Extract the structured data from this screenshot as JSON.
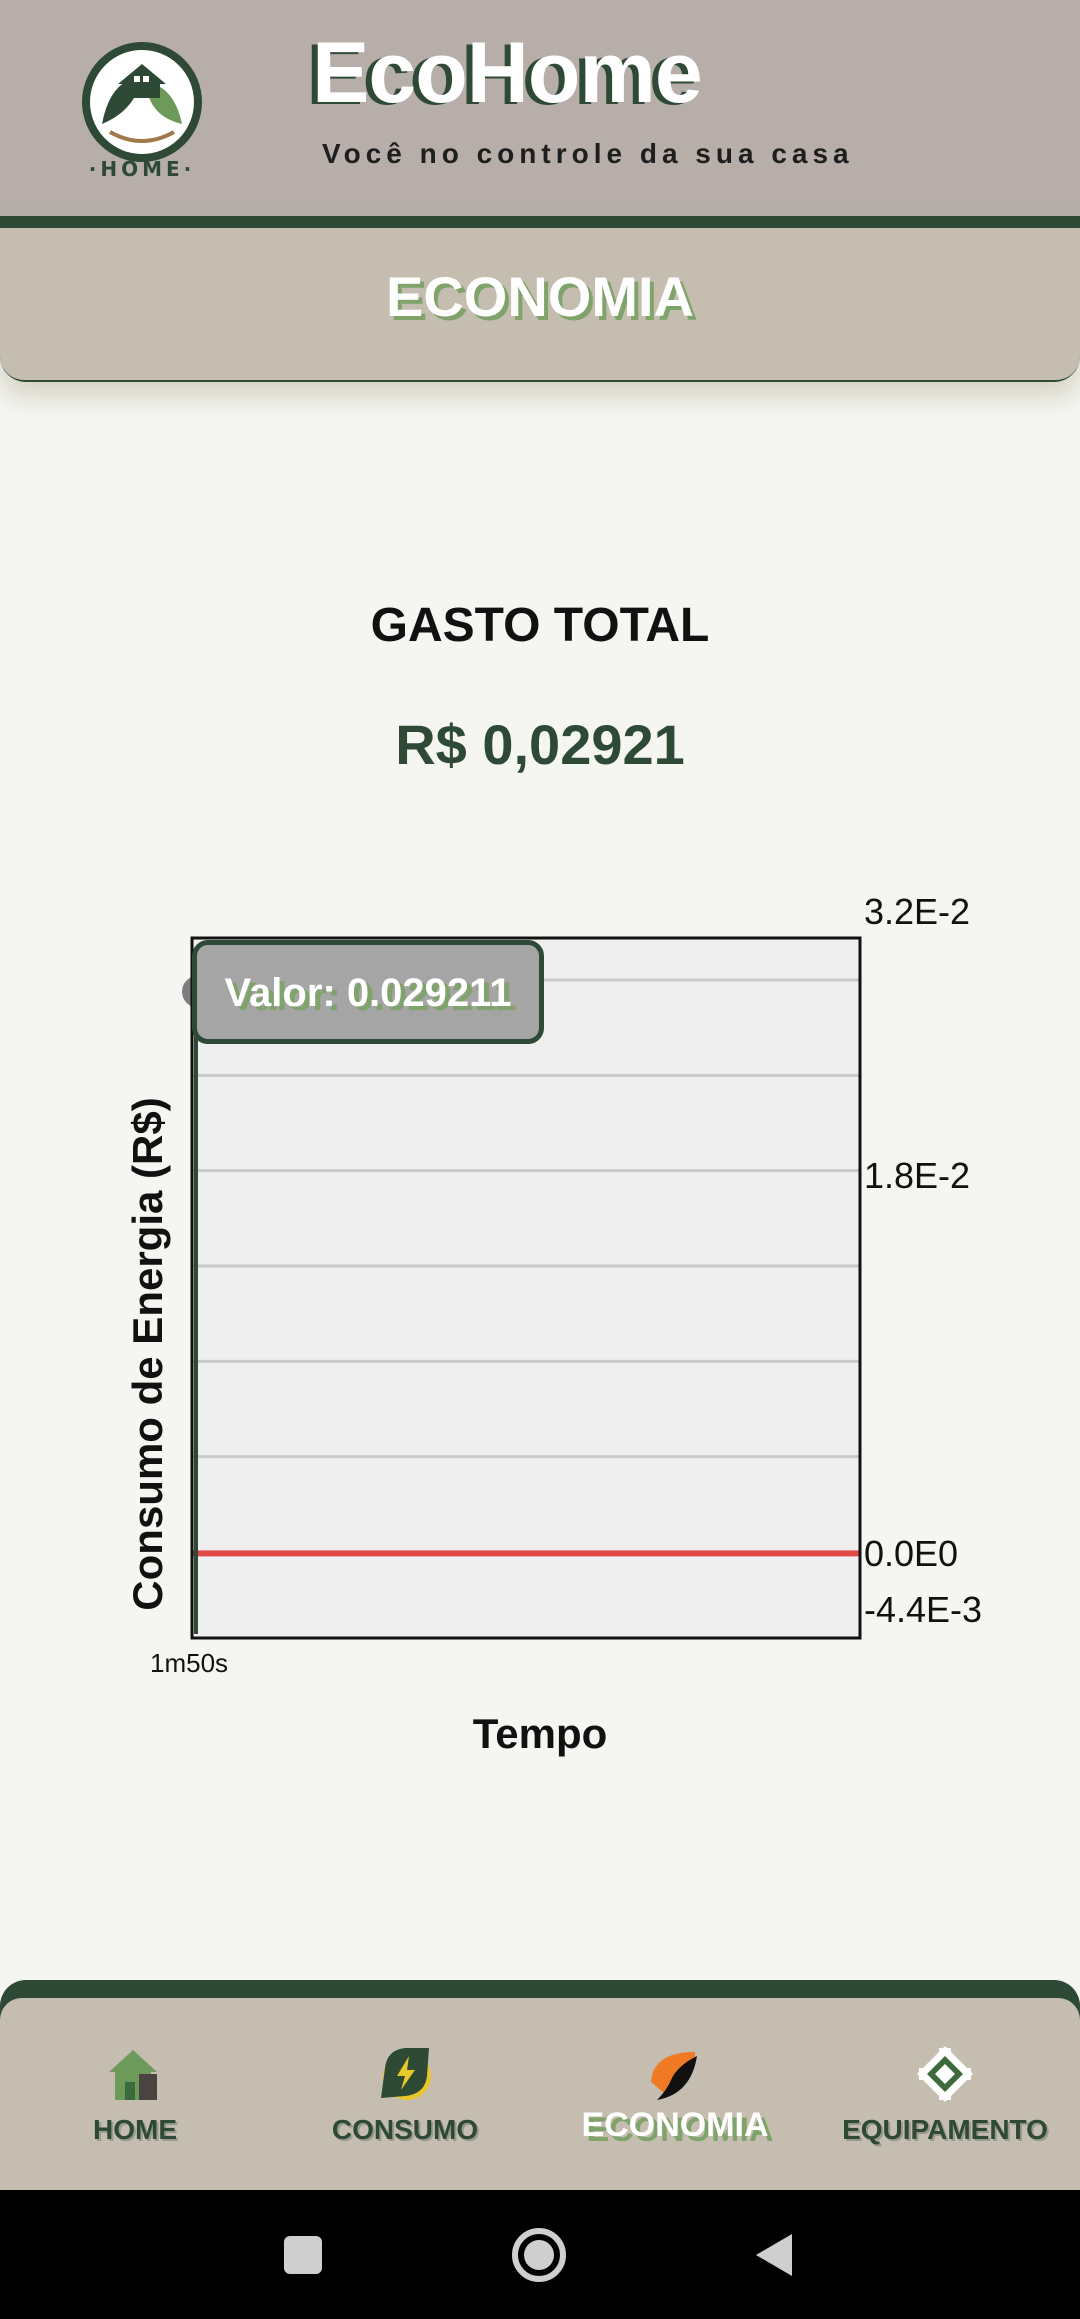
{
  "header": {
    "brand_title": "EcoHome",
    "tagline": "Você no controle da sua casa",
    "logo_text": "·HOME·"
  },
  "banner": {
    "title": "ECONOMIA"
  },
  "summary": {
    "label": "GASTO TOTAL",
    "value": "R$ 0,02921"
  },
  "chart_data": {
    "type": "line",
    "ylabel": "Consumo de Energia (R$)",
    "xlabel": "Tempo",
    "x_ticks": [
      "1m50s"
    ],
    "y_ticks": [
      "3.2E-2",
      "1.8E-2",
      "0.0E0",
      "-4.4E-3"
    ],
    "ylim": [
      -0.0044,
      0.032
    ],
    "grid": true,
    "series": [
      {
        "values": [
          0.0,
          0.0
        ],
        "color": "#e04a46"
      }
    ],
    "data_point": {
      "x": "1m50s",
      "y": 0.029211
    },
    "tooltip": "Valor: 0.029211"
  },
  "nav": {
    "items": [
      {
        "label": "HOME",
        "icon": "home-icon"
      },
      {
        "label": "CONSUMO",
        "icon": "bolt-icon"
      },
      {
        "label": "ECONOMIA",
        "icon": "leaf-icon"
      },
      {
        "label": "EQUIPAMENTO",
        "icon": "equipment-icon"
      }
    ],
    "active": "ECONOMIA"
  },
  "colors": {
    "header_bg": "#b7aeaa",
    "accent_dark": "#2e4a36",
    "accent_light": "#7fa36a",
    "panel_bg": "#c5beb0",
    "page_bg": "#f5f6f2",
    "line_red": "#e04a46"
  }
}
